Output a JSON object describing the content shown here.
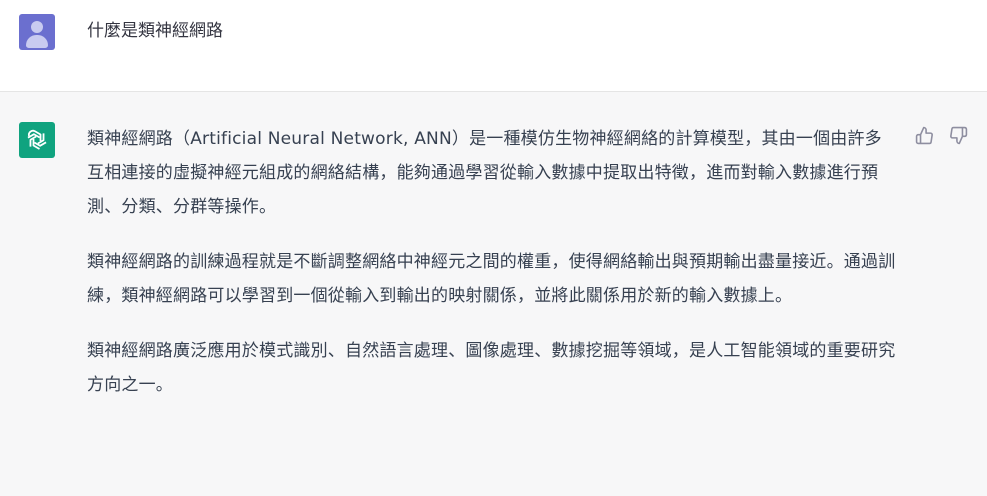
{
  "user_message": {
    "text": "什麼是類神經網路",
    "avatar_icon": "user-avatar-icon"
  },
  "assistant_message": {
    "avatar_icon": "openai-logo-icon",
    "paragraphs": [
      "類神經網路（Artificial Neural Network, ANN）是一種模仿生物神經網絡的計算模型，其由一個由許多互相連接的虛擬神經元組成的網絡結構，能夠通過學習從輸入數據中提取出特徵，進而對輸入數據進行預測、分類、分群等操作。",
      "類神經網路的訓練過程就是不斷調整網絡中神經元之間的權重，使得網絡輸出與預期輸出盡量接近。通過訓練，類神經網路可以學習到一個從輸入到輸出的映射關係，並將此關係用於新的輸入數據上。",
      "類神經網路廣泛應用於模式識別、自然語言處理、圖像處理、數據挖掘等領域，是人工智能領域的重要研究方向之一。"
    ],
    "feedback": {
      "thumbs_up_icon": "thumbs-up-icon",
      "thumbs_down_icon": "thumbs-down-icon"
    }
  },
  "colors": {
    "user_avatar": "#6b6fcf",
    "assistant_avatar": "#10a37f",
    "assistant_background": "#f7f7f8",
    "text": "#374151"
  }
}
